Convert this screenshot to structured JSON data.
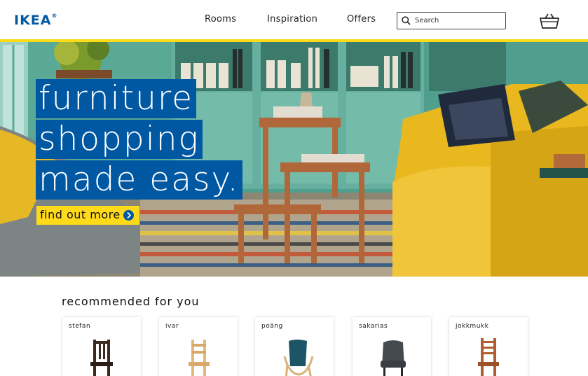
{
  "header": {
    "logo": "IKEA",
    "nav": [
      "Rooms",
      "Inspiration",
      "Offers"
    ],
    "search_placeholder": "Search",
    "icons": [
      "search-icon",
      "basket-icon"
    ]
  },
  "hero": {
    "headline": [
      "furniture",
      "shopping",
      "made easy."
    ],
    "cta_label": "find out more",
    "cta_icon": "chevron-right-icon"
  },
  "recommended": {
    "title": "recommended for you",
    "products": [
      {
        "name": "stefan",
        "icon": "dark-wood-chair-icon"
      },
      {
        "name": "ivar",
        "icon": "pine-chair-icon"
      },
      {
        "name": "poäng",
        "icon": "armchair-icon"
      },
      {
        "name": "sakarias",
        "icon": "upholstered-chair-icon"
      },
      {
        "name": "jokkmukk",
        "icon": "brown-wood-chair-icon"
      }
    ]
  },
  "colors": {
    "brand_blue": "#0058a3",
    "brand_yellow": "#ffda1a",
    "wall_teal": "#4f9e8e",
    "sofa_yellow": "#e8b81e"
  }
}
